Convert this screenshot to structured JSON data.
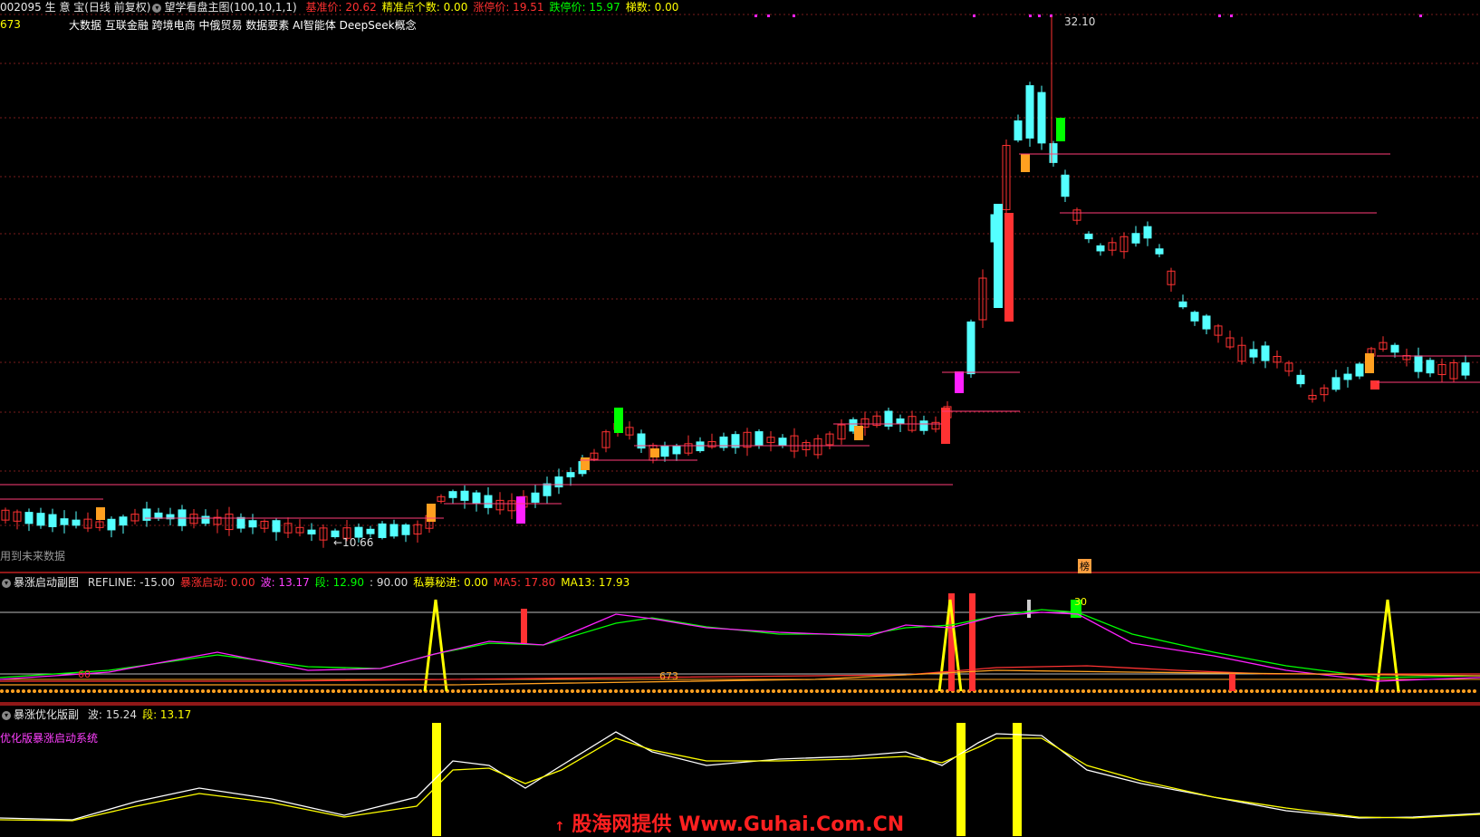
{
  "main_panel": {
    "title": "002095 生 意 宝(日线 前复权)",
    "indicator_name": "望学看盘主图(100,10,1,1)",
    "fields": [
      {
        "label": "基准价:",
        "value": "20.62",
        "color": "#ff3030"
      },
      {
        "label": "精准点个数:",
        "value": "0.00",
        "color": "#ffff00"
      },
      {
        "label": "涨停价:",
        "value": "19.51",
        "color": "#ff3030"
      },
      {
        "label": "跌停价:",
        "value": "15.97",
        "color": "#00ff00"
      },
      {
        "label": "梯数:",
        "value": "0.00",
        "color": "#ffff00"
      }
    ],
    "left_value": "673",
    "concepts": "大数据 互联金融 跨境电商 中俄贸易 数据要素 AI智能体 DeepSeek概念",
    "high_label": "32.10",
    "low_label": "←10.66",
    "future_note": "用到未来数据",
    "marker_text": "榜"
  },
  "sub_panel_1": {
    "title": "暴涨启动副图",
    "fields": [
      {
        "label": "REFLINE:",
        "value": "-15.00",
        "color": "#dddddd"
      },
      {
        "label": "暴涨启动:",
        "value": "0.00",
        "color": "#ff3030"
      },
      {
        "label": "波:",
        "value": "13.17",
        "color": "#ff40ff"
      },
      {
        "label": "段:",
        "value": "12.90",
        "color": "#00ff00"
      },
      {
        "label": ":",
        "value": "90.00",
        "color": "#dddddd"
      },
      {
        "label": "私募秘进:",
        "value": "0.00",
        "color": "#ffff00"
      },
      {
        "label": "MA5:",
        "value": "17.80",
        "color": "#ff3030"
      },
      {
        "label": "MA13:",
        "value": "17.93",
        "color": "#ffff00"
      }
    ],
    "label_60": "60",
    "label_673": "673",
    "label_30": "30"
  },
  "sub_panel_2": {
    "title": "暴涨优化版副",
    "fields": [
      {
        "label": "波:",
        "value": "15.24",
        "color": "#dddddd"
      },
      {
        "label": "段:",
        "value": "13.17",
        "color": "#ffff00"
      }
    ],
    "subtitle": "优化版暴涨启动系统"
  },
  "watermark": "股海网提供 Www.Guhai.Com.CN",
  "colors": {
    "up": "#ff3232",
    "down": "#54ffff",
    "grid": "#7a1c1c",
    "separator": "#c02020",
    "pink_line": "#ff3c78",
    "magenta": "#ff20ff",
    "orange": "#ffa020",
    "green": "#00ff00",
    "yellow": "#ffff00"
  }
}
